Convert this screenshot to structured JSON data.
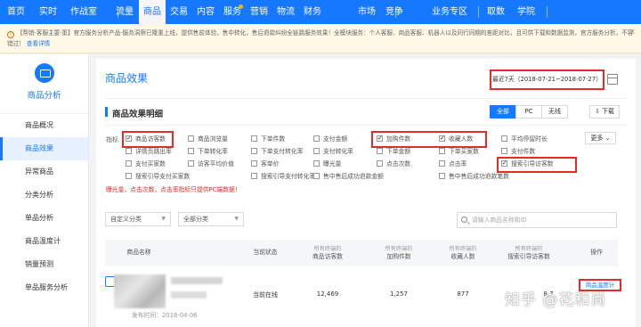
{
  "nav": {
    "items": [
      "首页",
      "实时",
      "作战室",
      "流量",
      "商品",
      "交易",
      "内容",
      "服务",
      "营销",
      "物流",
      "财务",
      "市场",
      "竞争",
      "业务专区",
      "取数",
      "学院"
    ],
    "active": "商品"
  },
  "notice": {
    "text": "【帮销·客服主要·策】官方服务分析产品-服务洞察已隆重上线，提供售前体验，售中转化，售后退款纠纷全链路服务效果！全模块服务：个人客服、商品客服、机器人以及同行同期的差距对比，且可供下载和数据监测，官方服务分析，不容错过！",
    "link": "查看详情"
  },
  "sidebar": {
    "title": "商品分析",
    "items": [
      "商品概况",
      "商品效果",
      "异常商品",
      "分类分析",
      "单品分析",
      "商品温度计",
      "销量预测",
      "单品服务分析"
    ],
    "active": "商品效果"
  },
  "main": {
    "title": "商品效果",
    "date_range": "最近7天（2018-07-21~2018-07-27）"
  },
  "detail": {
    "title": "商品效果明细",
    "terminal_tabs": [
      "全部",
      "PC",
      "无线"
    ],
    "active_terminal": "全部",
    "download_label": "下载",
    "metrics_label": "指标",
    "more_label": "更多",
    "metrics": [
      {
        "label": "商品访客数",
        "checked": true
      },
      {
        "label": "商品浏览量",
        "checked": false
      },
      {
        "label": "下单件数",
        "checked": false
      },
      {
        "label": "支付金额",
        "checked": false
      },
      {
        "label": "加购件数",
        "checked": true
      },
      {
        "label": "收藏人数",
        "checked": true
      },
      {
        "label": "平均停留时长",
        "checked": false
      },
      {
        "label": "详情页跳出率",
        "checked": false
      },
      {
        "label": "下单转化率",
        "checked": false
      },
      {
        "label": "下单支付转化率",
        "checked": false
      },
      {
        "label": "支付转化率",
        "checked": false
      },
      {
        "label": "下单金额",
        "checked": false
      },
      {
        "label": "下单买家数",
        "checked": false
      },
      {
        "label": "支付件数",
        "checked": false
      },
      {
        "label": "支付买家数",
        "checked": false
      },
      {
        "label": "访客平均价值",
        "checked": false
      },
      {
        "label": "客单价",
        "checked": false
      },
      {
        "label": "曝光量",
        "checked": false
      },
      {
        "label": "点击次数",
        "checked": false
      },
      {
        "label": "点击率",
        "checked": false
      },
      {
        "label": "搜索引导访客数",
        "checked": true
      },
      {
        "label": "搜索引导支付买家数",
        "checked": false
      },
      {
        "label": "搜索引导支付转化率",
        "checked": false
      },
      {
        "label": "售中售后成功退款金额",
        "checked": false
      },
      {
        "label": "售中售后成功退款笔数",
        "checked": false
      }
    ],
    "hint": "曝光量，点击次数，点击率指标只提供PC端数据！"
  },
  "filters": {
    "category": "自定义分类",
    "all_category": "全部分类",
    "search_placeholder": "请输入商品名称和ID"
  },
  "table": {
    "columns": [
      {
        "group": "",
        "label": "商品名称"
      },
      {
        "group": "",
        "label": "当前状态"
      },
      {
        "group": "所有终端的",
        "label": "商品访客数"
      },
      {
        "group": "所有终端的",
        "label": "加购件数"
      },
      {
        "group": "所有终端的",
        "label": "收藏人数"
      },
      {
        "group": "所有终端的",
        "label": "搜索引导访客数"
      },
      {
        "group": "",
        "label": "操作"
      }
    ],
    "rows": [
      {
        "publish_time": "发布时间：2018-04-06",
        "status": "当前在线",
        "visitors": "12,469",
        "cart": "1,257",
        "favorites": "877",
        "search_visitors": "8,7",
        "action": "商品温度计"
      }
    ]
  },
  "watermark": "知乎 @花和尚"
}
